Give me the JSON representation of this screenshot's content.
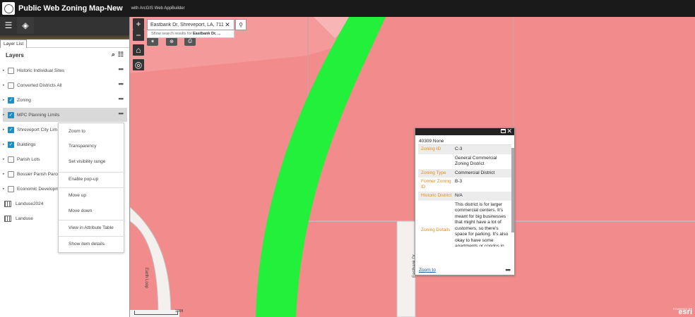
{
  "header": {
    "title": "Public Web Zoning Map-New",
    "subtitle": "with ArcGIS Web AppBuilder"
  },
  "panel": {
    "tab_label": "Layer List",
    "layers_title": "Layers",
    "layers": [
      {
        "label": "Historic Individual Sites",
        "checked": false,
        "type": "layer"
      },
      {
        "label": "Converted Districts All",
        "checked": false,
        "type": "layer"
      },
      {
        "label": "Zoning",
        "checked": true,
        "type": "layer"
      },
      {
        "label": "MPC Planning Limits",
        "checked": true,
        "type": "layer"
      },
      {
        "label": "Shreveport City Lim",
        "checked": true,
        "type": "layer"
      },
      {
        "label": "Buildings",
        "checked": true,
        "type": "layer"
      },
      {
        "label": "Parish Lots",
        "checked": false,
        "type": "layer"
      },
      {
        "label": "Bossier Parish Parcel",
        "checked": false,
        "type": "layer"
      },
      {
        "label": "Economic Developm",
        "checked": false,
        "type": "layer"
      },
      {
        "label": "Landuse2024",
        "checked": false,
        "type": "table"
      },
      {
        "label": "Landuse",
        "checked": false,
        "type": "table"
      }
    ]
  },
  "context_menu": {
    "items": [
      "Zoom to",
      "Transparency",
      "Set visibility range",
      "Enable pop-up",
      "Move up",
      "Move down",
      "View in Attribute Table",
      "Show item details"
    ]
  },
  "search": {
    "value": "Eastbank Dr, Shreveport, LA, 711",
    "hint_prefix": "Show search results for",
    "hint_term": "Eastbank Dr, ..."
  },
  "popup": {
    "title": "40309 None",
    "fields": [
      {
        "key": "Zoning ID",
        "value": "C-3"
      },
      {
        "key": "",
        "value": "General Commercial Zoning District"
      },
      {
        "key": "Zoning Type",
        "value": "Commercial District"
      },
      {
        "key": "Former Zoning ID",
        "value": "B-3"
      },
      {
        "key": "Historic District",
        "value": "N/A"
      },
      {
        "key": "Zoning Details",
        "value": "This district is for larger commercial centers. It's meant for big businesses that might have a lot of customers, so there's space for parking. It's also okay to have some apartments or condos in"
      }
    ],
    "zoom_to": "Zoom to"
  },
  "map": {
    "road_label_1": "Earth Loop",
    "road_label_2": "Eastbank Dr",
    "scale_label": "100ft",
    "attribution_small": "POWERED BY",
    "attribution_logo": "esri"
  },
  "colors": {
    "zone_pink": "#f28c8c",
    "green_corridor": "#22f03a",
    "header_bg": "#1a1a1a",
    "check_blue": "#1e8fc6",
    "field_key_orange": "#e58a1d"
  }
}
